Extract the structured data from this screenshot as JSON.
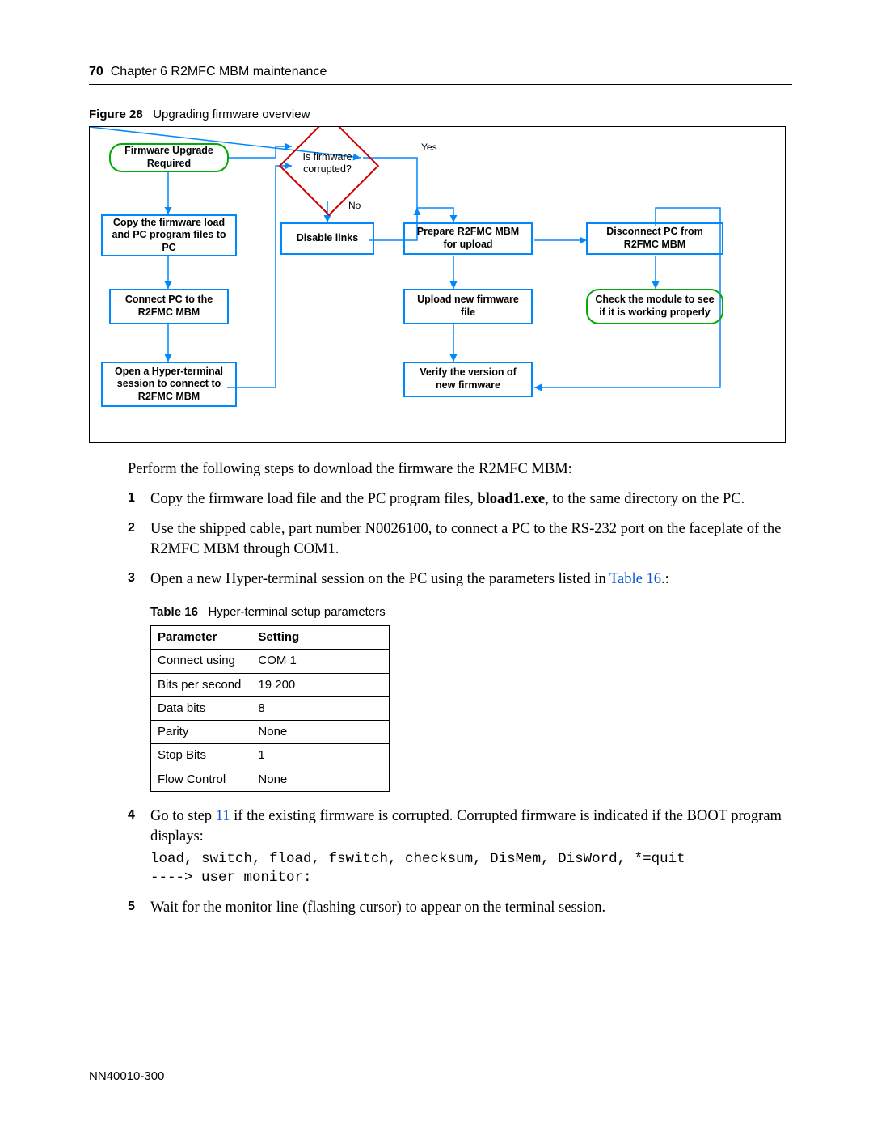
{
  "header": {
    "page_number": "70",
    "chapter": "Chapter 6  R2MFC MBM maintenance"
  },
  "figure": {
    "label": "Figure 28",
    "title": "Upgrading firmware overview",
    "nodes": {
      "start": "Firmware Upgrade Required",
      "decision": "Is firmware corrupted?",
      "yes": "Yes",
      "no": "No",
      "copy": "Copy the firmware load and PC program files to PC",
      "disable": "Disable links",
      "prepare": "Prepare R2FMC MBM for upload",
      "disconnect": "Disconnect PC from R2FMC MBM",
      "connectpc": "Connect PC to the R2FMC MBM",
      "upload": "Upload  new firmware file",
      "check": "Check the module to see if it is working properly",
      "hyper": "Open a Hyper-terminal session to connect to R2FMC MBM",
      "verify": "Verify the version of new   firmware"
    }
  },
  "intro": "Perform the following steps to download the firmware the R2MFC MBM:",
  "steps": {
    "s1a": "Copy the firmware load file and the PC program files, ",
    "s1b": "bload1.exe",
    "s1c": ", to the same directory on the PC.",
    "s2": "Use the shipped cable, part number N0026100, to connect a PC to the RS-232 port on the faceplate of the R2MFC MBM through COM1.",
    "s3a": "Open a new Hyper-terminal session on the PC using the parameters listed in ",
    "s3link": "Table 16",
    "s3b": ".:",
    "s4a": "Go to step ",
    "s4link": "11",
    "s4b": " if the existing firmware is corrupted. Corrupted firmware is indicated if the BOOT program displays:",
    "s4code1": "load, switch, fload, fswitch, checksum, DisMem, DisWord, *=quit",
    "s4code2": "----> user monitor:",
    "s5": "Wait for the monitor line (flashing cursor) to appear on the terminal session."
  },
  "table": {
    "label": "Table 16",
    "title": "Hyper-terminal setup parameters",
    "head": {
      "c1": "Parameter",
      "c2": "Setting"
    },
    "rows": [
      {
        "p": "Connect using",
        "s": "COM 1"
      },
      {
        "p": "Bits per second",
        "s": "19 200"
      },
      {
        "p": "Data bits",
        "s": "8"
      },
      {
        "p": "Parity",
        "s": "None"
      },
      {
        "p": "Stop Bits",
        "s": "1"
      },
      {
        "p": "Flow Control",
        "s": "None"
      }
    ]
  },
  "footer": {
    "docnum": "NN40010-300"
  }
}
